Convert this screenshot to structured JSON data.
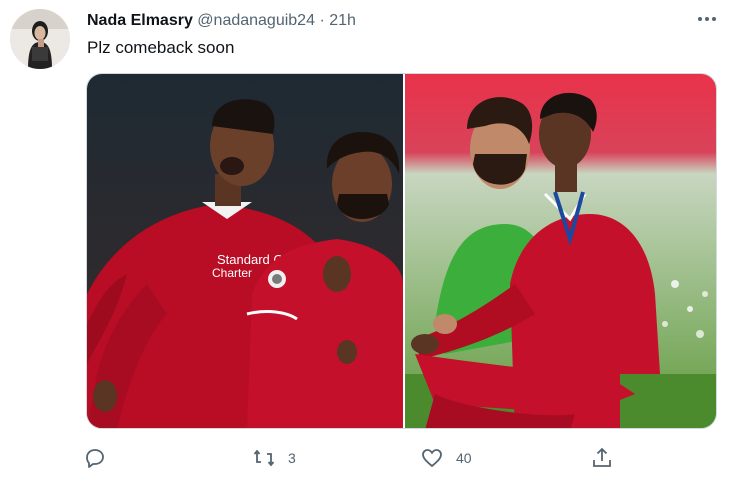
{
  "tweet": {
    "author_name": "Nada Elmasry",
    "handle": "@nadanaguib24",
    "separator": "·",
    "time": "21h",
    "text": "Plz comeback soon",
    "media": [
      {
        "jersey_sponsor": "Standard Chartered"
      },
      {
        "jersey_sponsor": ""
      }
    ]
  },
  "actions": {
    "reply_icon": "reply-icon",
    "retweet_icon": "retweet-icon",
    "retweet_count": "3",
    "like_icon": "heart-icon",
    "like_count": "40",
    "share_icon": "share-icon"
  },
  "colors": {
    "text_primary": "#0f1419",
    "text_secondary": "#536471",
    "jersey_red": "#c8102e",
    "pitch_green": "#5f9b3c"
  }
}
